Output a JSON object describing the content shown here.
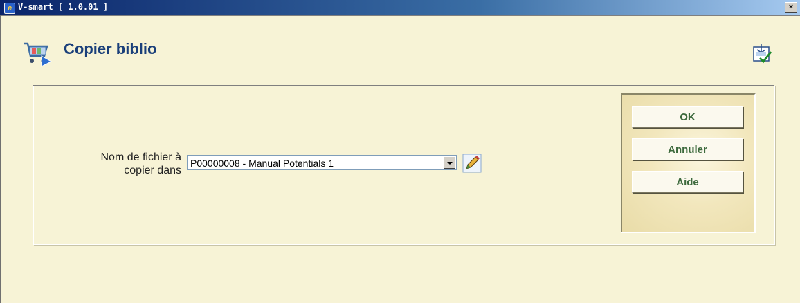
{
  "window": {
    "title": "V-smart [ 1.0.01 ]",
    "close_label": "×"
  },
  "header": {
    "title": "Copier biblio"
  },
  "form": {
    "label": "Nom de fichier à copier dans",
    "selected_value": "P00000008 - Manual Potentials 1"
  },
  "buttons": {
    "ok": "OK",
    "cancel": "Annuler",
    "help": "Aide"
  },
  "icons": {
    "app": "app-logo-icon",
    "header": "shopping-cart-icon",
    "corner": "layout-check-icon",
    "edit": "pencil-icon"
  },
  "colors": {
    "title": "#1a3f7a",
    "button_text": "#3d6a3d",
    "background": "#f7f3d6"
  }
}
